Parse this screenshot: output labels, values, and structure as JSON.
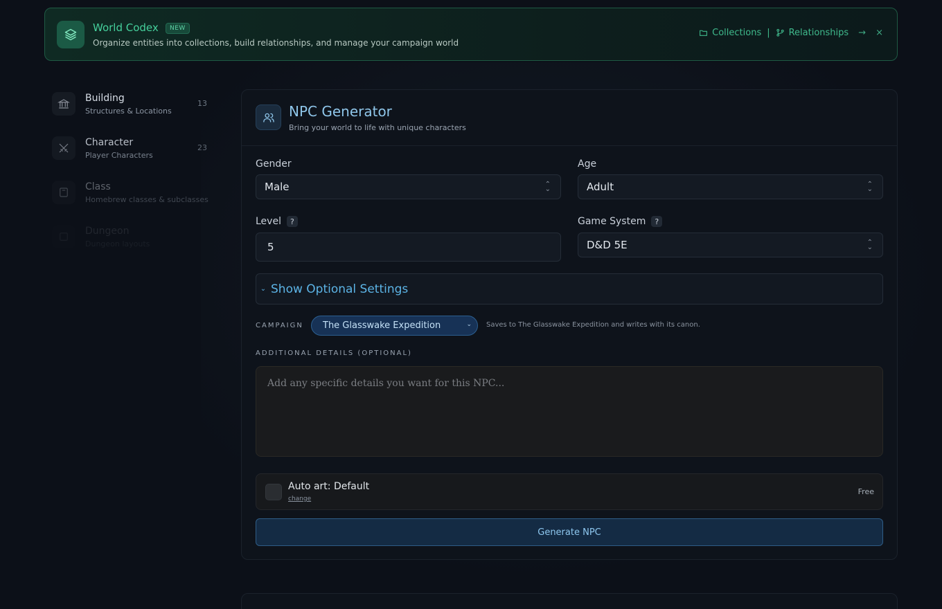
{
  "banner": {
    "title": "World Codex",
    "badge": "NEW",
    "description": "Organize entities into collections, build relationships, and manage your campaign world",
    "collections_label": "Collections",
    "separator": "|",
    "relationships_label": "Relationships",
    "arrow": "→",
    "close": "×"
  },
  "sidebar": {
    "items": [
      {
        "name": "Building",
        "sub": "Structures & Locations",
        "count": "13",
        "icon": "building-icon"
      },
      {
        "name": "Character",
        "sub": "Player Characters",
        "count": "23",
        "icon": "swords-icon"
      },
      {
        "name": "Class",
        "sub": "Homebrew classes & subclasses ...",
        "count": "",
        "icon": "book-icon"
      },
      {
        "name": "Dungeon",
        "sub": "Dungeon layouts",
        "count": "",
        "icon": "dungeon-icon"
      }
    ]
  },
  "generator": {
    "title": "NPC Generator",
    "subtitle": "Bring your world to life with unique characters",
    "gender_label": "Gender",
    "gender_value": "Male",
    "age_label": "Age",
    "age_value": "Adult",
    "level_label": "Level",
    "level_value": "5",
    "system_label": "Game System",
    "system_value": "D&D 5E",
    "help_mark": "?",
    "optional_label": "Show Optional Settings",
    "campaign_label": "CAMPAIGN",
    "campaign_value": "The Glasswake Expedition",
    "campaign_note": "Saves to The Glasswake Expedition and writes with its canon.",
    "details_label": "ADDITIONAL DETAILS (OPTIONAL)",
    "details_placeholder": "Add any specific details you want for this NPC...",
    "autoart_title": "Auto art: Default",
    "autoart_change": "change",
    "autoart_price": "Free",
    "generate_label": "Generate NPC"
  },
  "colors": {
    "accent_green": "#45d09c",
    "accent_blue": "#5cb4e6",
    "background": "#0c1018"
  }
}
